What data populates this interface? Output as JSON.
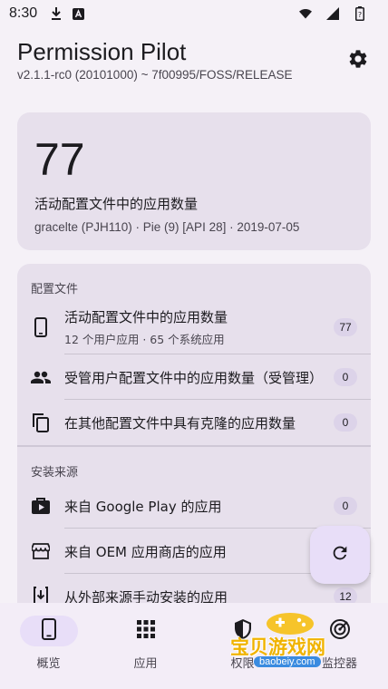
{
  "status_bar": {
    "time": "8:30"
  },
  "header": {
    "title": "Permission Pilot",
    "version": "v2.1.1-rc0 (20101000) ~ 7f00995/FOSS/RELEASE"
  },
  "summary": {
    "count": "77",
    "label": "活动配置文件中的应用数量",
    "device": "gracelte (PJH110) · Pie (9) [API 28] · 2019-07-05"
  },
  "sections": [
    {
      "title": "配置文件",
      "rows": [
        {
          "icon": "phone-icon",
          "title": "活动配置文件中的应用数量",
          "subtitle": "12 个用户应用 · 65 个系统应用",
          "badge": "77"
        },
        {
          "icon": "people-icon",
          "title": "受管用户配置文件中的应用数量（受管理）",
          "badge": "0"
        },
        {
          "icon": "clone-icon",
          "title": "在其他配置文件中具有克隆的应用数量",
          "badge": "0"
        }
      ]
    },
    {
      "title": "安装来源",
      "rows": [
        {
          "icon": "play-store-icon",
          "title": "来自 Google Play 的应用",
          "badge": "0"
        },
        {
          "icon": "store-icon",
          "title": "来自 OEM 应用商店的应用",
          "badge": ""
        },
        {
          "icon": "install-icon",
          "title": "从外部来源手动安装的应用",
          "badge": "12"
        }
      ]
    }
  ],
  "bottom_nav": {
    "items": [
      {
        "label": "概览",
        "icon": "phone-icon"
      },
      {
        "label": "应用",
        "icon": "grid-icon"
      },
      {
        "label": "权限",
        "icon": "shield-icon"
      },
      {
        "label": "监控器",
        "icon": "radar-icon"
      }
    ]
  },
  "watermark": {
    "text": "宝贝游戏网",
    "url": "baobeiy.com"
  }
}
